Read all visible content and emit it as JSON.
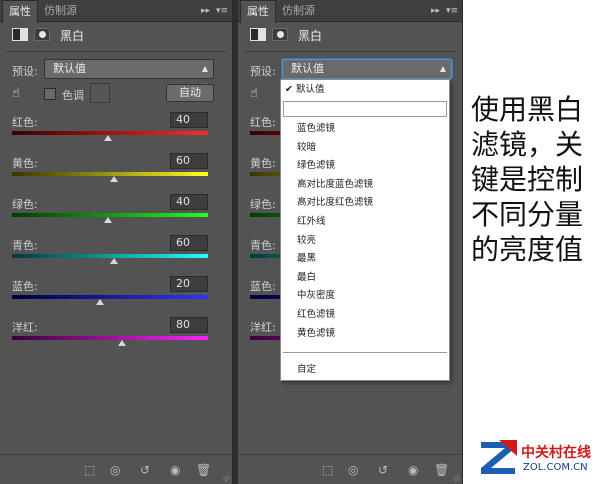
{
  "tabs": {
    "active": "属性",
    "inactive": "仿制源"
  },
  "tab_controls": {
    "collapse": "▸▸",
    "menu": "▾≡"
  },
  "header": {
    "title": "黑白"
  },
  "preset": {
    "label": "预设:",
    "value": "默认值"
  },
  "tint": {
    "label": "色调",
    "checked": false
  },
  "auto_button": "自动",
  "sliders": [
    {
      "label": "红色:",
      "value": "40",
      "percent": 49,
      "gradient": [
        "#3a0000",
        "#ff2a2a"
      ]
    },
    {
      "label": "黄色:",
      "value": "60",
      "percent": 52,
      "gradient": [
        "#3a3300",
        "#ffff22"
      ]
    },
    {
      "label": "绿色:",
      "value": "40",
      "percent": 49,
      "gradient": [
        "#003a00",
        "#22ff22"
      ]
    },
    {
      "label": "青色:",
      "value": "60",
      "percent": 52,
      "gradient": [
        "#003a3a",
        "#22ffff"
      ]
    },
    {
      "label": "蓝色:",
      "value": "20",
      "percent": 45,
      "gradient": [
        "#00003a",
        "#3333ff"
      ]
    },
    {
      "label": "洋红:",
      "value": "80",
      "percent": 56,
      "gradient": [
        "#3a003a",
        "#ff22ff"
      ]
    }
  ],
  "dropdown": {
    "checked_item": "默认值",
    "items": [
      "蓝色滤镜",
      "较暗",
      "绿色滤镜",
      "高对比度蓝色滤镜",
      "高对比度红色滤镜",
      "红外线",
      "较亮",
      "最黑",
      "最白",
      "中灰密度",
      "红色滤镜",
      "黄色滤镜"
    ],
    "custom": "自定"
  },
  "caption": [
    "使用黑白",
    "滤镜，关",
    "键是控制",
    "不同分量",
    "的亮度值"
  ],
  "logo": {
    "cn": "中关村在线",
    "en": "ZOL.COM.CN"
  },
  "colors": {
    "panel_bg": "#535353",
    "tab_bar": "#3f3f3f",
    "accent_blue": "#3f6fb5",
    "logo_red": "#d11a1a",
    "logo_blue": "#1a3a8a"
  }
}
